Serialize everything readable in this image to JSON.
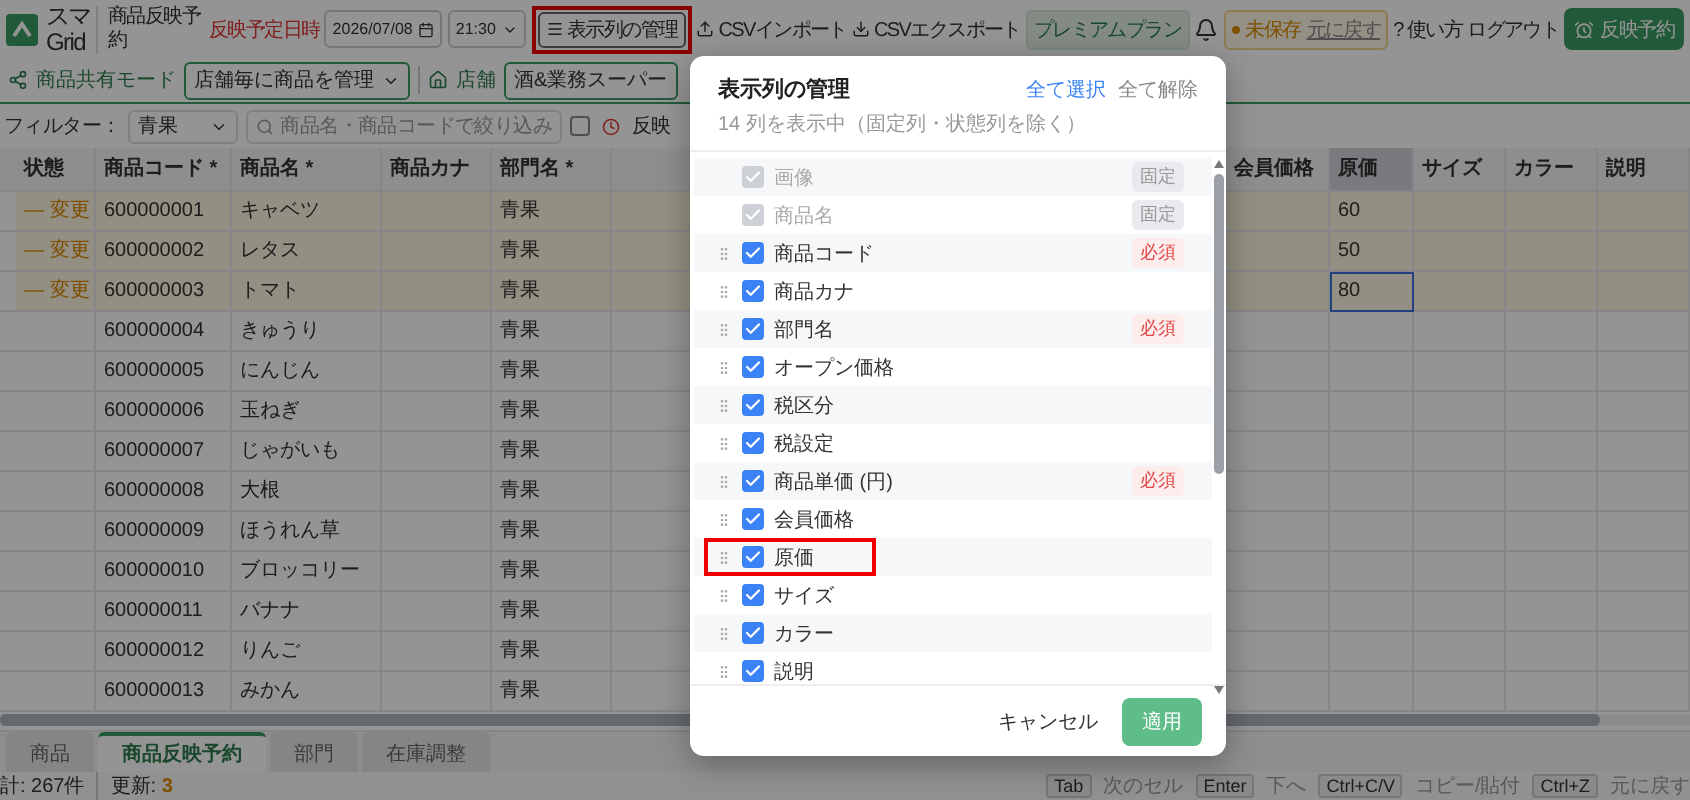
{
  "header": {
    "logo_text": [
      "スマ",
      "Grid"
    ],
    "page_title": "商品反映予約",
    "schedule_label": "反映予定日時",
    "date": "2026/07/08",
    "time": "21:30",
    "columns_button": {
      "label": "表示列の管理",
      "highlighted": true
    },
    "import_button": "CSVインポート",
    "export_button": "CSVエクスポート",
    "plan_badge": "プレミアムプラン",
    "unsaved": {
      "label": "未保存",
      "undo": "元に戻す"
    },
    "help_mark": "?",
    "help": "使い方",
    "logout": "ログアウト",
    "schedule_button": "反映予約"
  },
  "mode_bar": {
    "mode_label": "商品共有モード",
    "mode_value": "店舗毎に商品を管理",
    "store_label": "店舗",
    "store_value": "酒&業務スーパー"
  },
  "filter_bar": {
    "label": "フィルター：",
    "category": "青果",
    "search_placeholder": "商品名・商品コードで絞り込み",
    "checkbox": {
      "label": "反映",
      "checked": false
    }
  },
  "table": {
    "left_columns": [
      "状態",
      "商品コード *",
      "商品名 *",
      "商品カナ",
      "部門名 *"
    ],
    "right_columns": [
      {
        "label": "会員価格",
        "selected": false
      },
      {
        "label": "原価",
        "selected": true
      },
      {
        "label": "サイズ",
        "selected": false
      },
      {
        "label": "カラー",
        "selected": false
      },
      {
        "label": "説明",
        "selected": false
      }
    ],
    "rows": [
      {
        "changed": true,
        "status": "— 変更",
        "code": "600000001",
        "name": "キャベツ",
        "department": "青果",
        "cost": {
          "text": "60",
          "selected": false
        }
      },
      {
        "changed": true,
        "status": "— 変更",
        "code": "600000002",
        "name": "レタス",
        "department": "青果",
        "cost": {
          "text": "50",
          "selected": false
        }
      },
      {
        "changed": true,
        "status": "— 変更",
        "code": "600000003",
        "name": "トマト",
        "department": "青果",
        "cost": {
          "text": "80",
          "selected": true
        }
      },
      {
        "changed": false,
        "code": "600000004",
        "name": "きゅうり",
        "department": "青果"
      },
      {
        "changed": false,
        "code": "600000005",
        "name": "にんじん",
        "department": "青果"
      },
      {
        "changed": false,
        "code": "600000006",
        "name": "玉ねぎ",
        "department": "青果"
      },
      {
        "changed": false,
        "code": "600000007",
        "name": "じゃがいも",
        "department": "青果"
      },
      {
        "changed": false,
        "code": "600000008",
        "name": "大根",
        "department": "青果"
      },
      {
        "changed": false,
        "code": "600000009",
        "name": "ほうれん草",
        "department": "青果"
      },
      {
        "changed": false,
        "code": "600000010",
        "name": "ブロッコリー",
        "department": "青果"
      },
      {
        "changed": false,
        "code": "600000011",
        "name": "バナナ",
        "department": "青果"
      },
      {
        "changed": false,
        "code": "600000012",
        "name": "りんご",
        "department": "青果"
      },
      {
        "changed": false,
        "code": "600000013",
        "name": "みかん",
        "department": "青果"
      }
    ]
  },
  "bottom_tabs": [
    {
      "label": "商品",
      "selected": false
    },
    {
      "label": "商品反映予約",
      "selected": true
    },
    {
      "label": "部門",
      "selected": false
    },
    {
      "label": "在庫調整",
      "selected": false
    }
  ],
  "status_bar": {
    "total": "計: 267件",
    "updated_label": "更新:",
    "updated_count": "3",
    "shortcuts": [
      {
        "key": "Tab",
        "action": "次のセル"
      },
      {
        "key": "Enter",
        "action": "下へ"
      },
      {
        "key": "Ctrl+C/V",
        "action": "コピー/貼付"
      },
      {
        "key": "Ctrl+Z",
        "action": "元に戻す"
      }
    ]
  },
  "dialog": {
    "title": "表示列の管理",
    "subtitle": "14 列を表示中（固定列・状態列を除く）",
    "select_all": "全て選択",
    "clear_all": "全て解除",
    "items": [
      {
        "kind": "fixed",
        "label": "画像",
        "checked": true,
        "badge": "固定",
        "highlighted": false
      },
      {
        "kind": "fixed",
        "label": "商品名",
        "checked": true,
        "badge": "固定",
        "highlighted": false
      },
      {
        "kind": "column",
        "label": "商品コード",
        "checked": true,
        "badge": "必須",
        "highlighted": false
      },
      {
        "kind": "column",
        "label": "商品カナ",
        "checked": true,
        "highlighted": false
      },
      {
        "kind": "column",
        "label": "部門名",
        "checked": true,
        "badge": "必須",
        "highlighted": false
      },
      {
        "kind": "column",
        "label": "オープン価格",
        "checked": true,
        "highlighted": false
      },
      {
        "kind": "column",
        "label": "税区分",
        "checked": true,
        "highlighted": false
      },
      {
        "kind": "column",
        "label": "税設定",
        "checked": true,
        "highlighted": false
      },
      {
        "kind": "column",
        "label": "商品単価 (円)",
        "checked": true,
        "badge": "必須",
        "highlighted": false
      },
      {
        "kind": "column",
        "label": "会員価格",
        "checked": true,
        "highlighted": false
      },
      {
        "kind": "column",
        "label": "原価",
        "checked": true,
        "highlighted": true
      },
      {
        "kind": "column",
        "label": "サイズ",
        "checked": true,
        "highlighted": false
      },
      {
        "kind": "column",
        "label": "カラー",
        "checked": true,
        "highlighted": false
      },
      {
        "kind": "column",
        "label": "説明",
        "checked": true,
        "highlighted": false
      }
    ],
    "cancel": "キャンセル",
    "apply": "適用"
  }
}
